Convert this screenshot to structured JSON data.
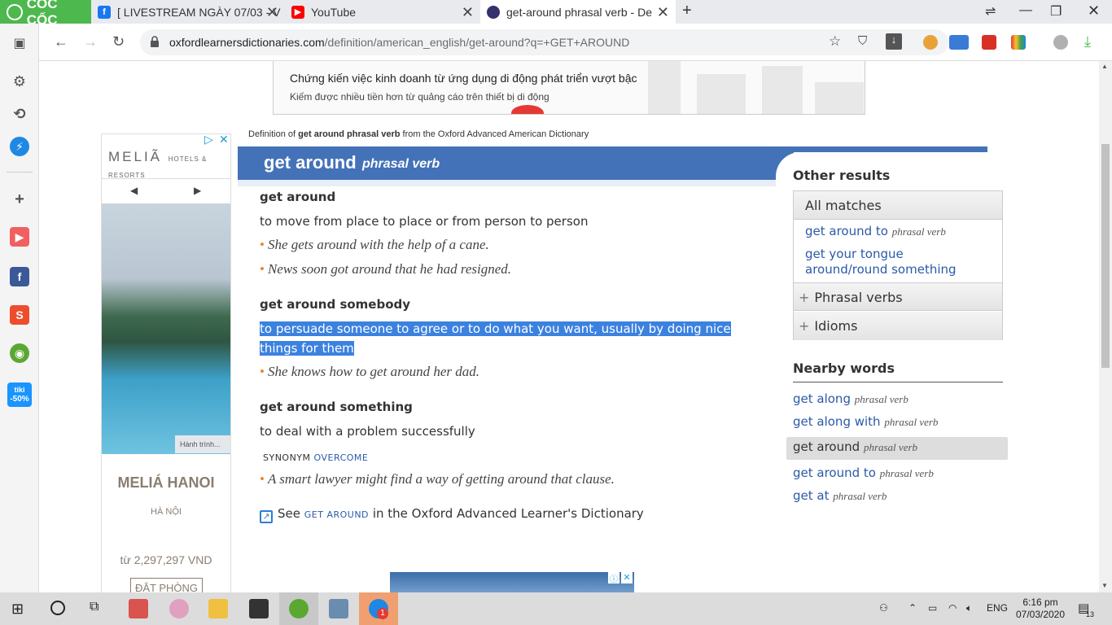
{
  "browser": {
    "logo_text": "CỐC CỐC",
    "tabs": [
      {
        "title": "[ LIVESTREAM NGÀY 07/03 - V",
        "icon": "facebook-icon",
        "color": "#1877f2"
      },
      {
        "title": "YouTube",
        "icon": "youtube-icon",
        "color": "#ff0000"
      },
      {
        "title": "get-around phrasal verb - De",
        "icon": "oxford-icon",
        "color": "#35306e"
      }
    ],
    "new_tab_label": "+",
    "url_host": "oxfordlearnersdictionaries.com",
    "url_path": "/definition/american_english/get-around?q=+GET+AROUND"
  },
  "top_ad": {
    "line1": "Chứng kiến việc kinh doanh từ ứng dụng di động phát triển vượt bậc",
    "line2": "Kiếm được nhiều tiền hơn từ quảng cáo trên thiết bị di động"
  },
  "left_ad": {
    "brand": "MELIÃ",
    "brand_sub": "HOTELS & RESORTS",
    "caption": "Hành trình...",
    "hotel": "MELIÁ HANOI",
    "city": "HÀ NỘI",
    "price": "từ 2,297,297 VND",
    "cta": "ĐẶT PHÒNG"
  },
  "breadcrumb": {
    "prefix": "Definition of",
    "bold": "get around phrasal verb",
    "suffix": "from the Oxford Advanced American Dictionary"
  },
  "entry": {
    "headword": "get around",
    "pos": "phrasal verb",
    "senses": [
      {
        "head": "get around",
        "def": "to move from place to place or from person to person",
        "examples": [
          "She gets around with the help of a cane.",
          "News soon got around that he had resigned."
        ]
      },
      {
        "head": "get around somebody",
        "def_line1": "to persuade someone to agree or to do what you want, usually by doing nice",
        "def_line2": "things for them",
        "examples": [
          "She knows how to get around her dad."
        ]
      },
      {
        "head": "get around something",
        "def": "to deal with a problem successfully",
        "synonym_label": "SYNONYM",
        "synonym": "OVERCOME",
        "examples": [
          "A smart lawyer might find a way of getting around that clause."
        ]
      }
    ],
    "see_prefix": "See",
    "see_link": "GET AROUND",
    "see_suffix": "in the Oxford Advanced Learner's Dictionary"
  },
  "other_results": {
    "title": "Other results",
    "all_matches": "All matches",
    "matches": [
      {
        "word": "get around to",
        "pos": "phrasal verb"
      },
      {
        "word_line1": "get your tongue",
        "word_line2": "around/round something"
      }
    ],
    "phrasal_verbs": "Phrasal verbs",
    "idioms": "Idioms"
  },
  "nearby": {
    "title": "Nearby words",
    "items": [
      {
        "word": "get along",
        "pos": "phrasal verb"
      },
      {
        "word": "get along with",
        "pos": "phrasal verb"
      },
      {
        "word": "get around",
        "pos": "phrasal verb"
      },
      {
        "word": "get around to",
        "pos": "phrasal verb"
      },
      {
        "word": "get at",
        "pos": "phrasal verb"
      }
    ]
  },
  "taskbar": {
    "lang": "ENG",
    "time": "6:16 pm",
    "date": "07/03/2020",
    "notifications": "13",
    "zalo_badge": "1"
  },
  "sidebar_promo": {
    "line1": "tiki",
    "line2": "-50%"
  },
  "colors": {
    "accent_blue": "#4472b8",
    "link_blue": "#2b5aa8",
    "selection": "#3b82e0",
    "coccoc_green": "#4db84d",
    "bullet_orange": "#e58a2b"
  }
}
